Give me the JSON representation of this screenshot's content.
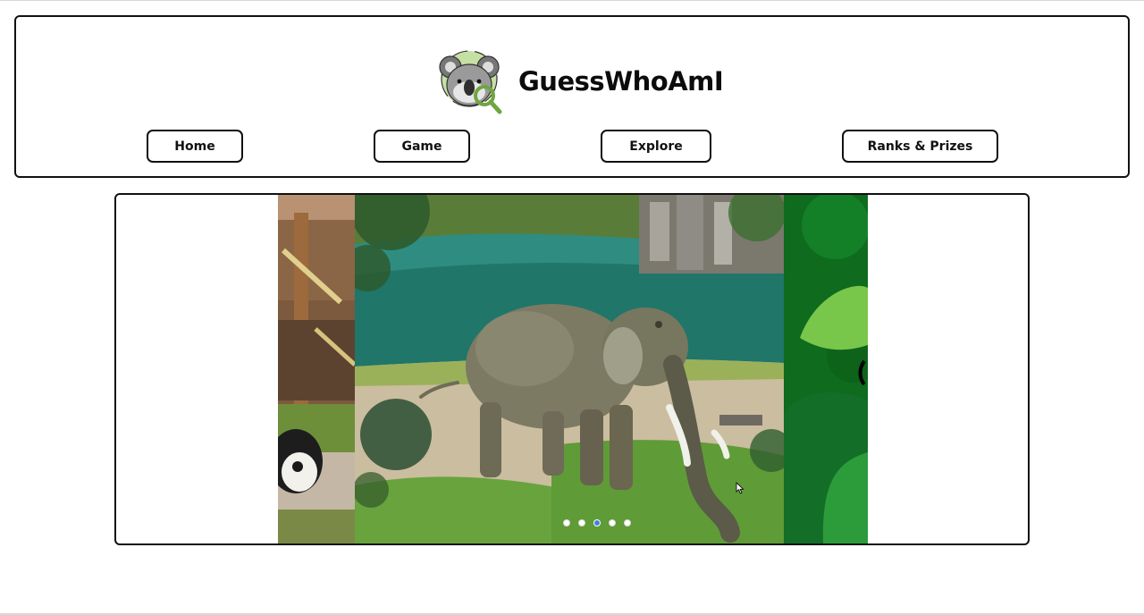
{
  "app": {
    "title": "GuessWhoAmI"
  },
  "nav": {
    "items": [
      {
        "label": "Home"
      },
      {
        "label": "Game"
      },
      {
        "label": "Explore"
      },
      {
        "label": "Ranks & Prizes"
      }
    ]
  },
  "carousel": {
    "slide_count": 5,
    "active_index": 2,
    "slides": [
      "panda",
      "elephant",
      "green-leaves"
    ]
  },
  "colors": {
    "border": "#111111",
    "logo_accent": "#8dbf5a",
    "active_dot": "#3f83d8"
  },
  "icons": {
    "logo": "koala-magnifier-icon"
  }
}
